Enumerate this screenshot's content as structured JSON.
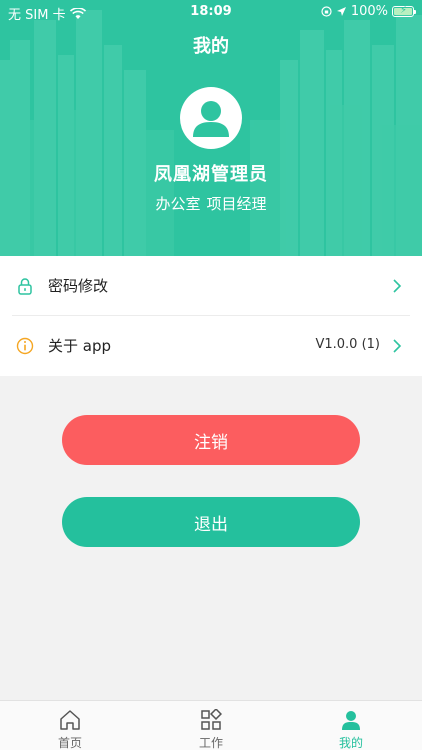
{
  "status_bar": {
    "carrier": "无 SIM 卡",
    "time": "18:09",
    "battery": "100%"
  },
  "header": {
    "title": "我的",
    "user_name": "凤凰湖管理员",
    "department": "办公室",
    "position": "项目经理"
  },
  "menu": {
    "items": [
      {
        "label": "密码修改",
        "icon": "lock-icon"
      },
      {
        "label": "关于 app",
        "value": "V1.0.0 (1)",
        "icon": "info-icon"
      }
    ]
  },
  "buttons": {
    "cancel_label": "注销",
    "logout_label": "退出"
  },
  "tabbar": {
    "items": [
      {
        "label": "首页",
        "icon": "home-icon"
      },
      {
        "label": "工作",
        "icon": "grid-icon"
      },
      {
        "label": "我的",
        "icon": "user-icon",
        "active": true
      }
    ]
  },
  "colors": {
    "brand": "#2ec4a0",
    "danger": "#fc5d5f",
    "accent": "#24c09d",
    "info_icon": "#f5a623"
  }
}
